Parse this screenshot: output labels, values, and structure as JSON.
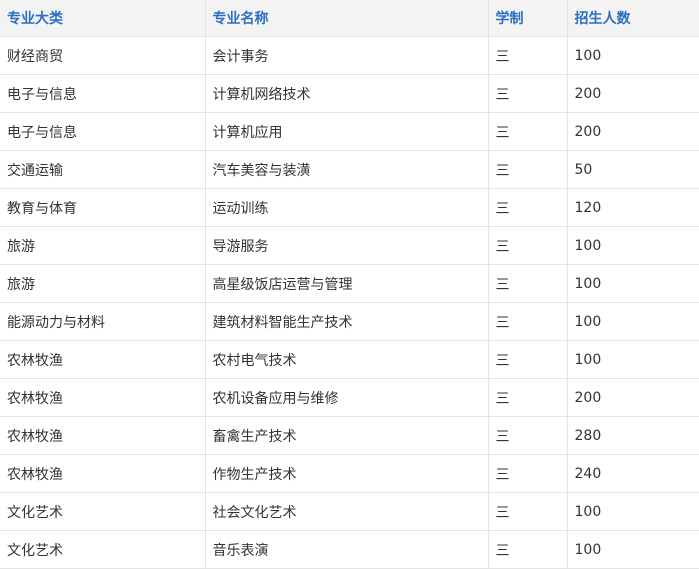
{
  "table": {
    "headers": [
      "专业大类",
      "专业名称",
      "学制",
      "招生人数"
    ],
    "rows": [
      [
        "财经商贸",
        "会计事务",
        "三",
        "100"
      ],
      [
        "电子与信息",
        "计算机网络技术",
        "三",
        "200"
      ],
      [
        "电子与信息",
        "计算机应用",
        "三",
        "200"
      ],
      [
        "交通运输",
        "汽车美容与装潢",
        "三",
        "50"
      ],
      [
        "教育与体育",
        "运动训练",
        "三",
        "120"
      ],
      [
        "旅游",
        "导游服务",
        "三",
        "100"
      ],
      [
        "旅游",
        "高星级饭店运营与管理",
        "三",
        "100"
      ],
      [
        "能源动力与材料",
        "建筑材料智能生产技术",
        "三",
        "100"
      ],
      [
        "农林牧渔",
        "农村电气技术",
        "三",
        "100"
      ],
      [
        "农林牧渔",
        "农机设备应用与维修",
        "三",
        "200"
      ],
      [
        "农林牧渔",
        "畜禽生产技术",
        "三",
        "280"
      ],
      [
        "农林牧渔",
        "作物生产技术",
        "三",
        "240"
      ],
      [
        "文化艺术",
        "社会文化艺术",
        "三",
        "100"
      ],
      [
        "文化艺术",
        "音乐表演",
        "三",
        "100"
      ]
    ]
  }
}
